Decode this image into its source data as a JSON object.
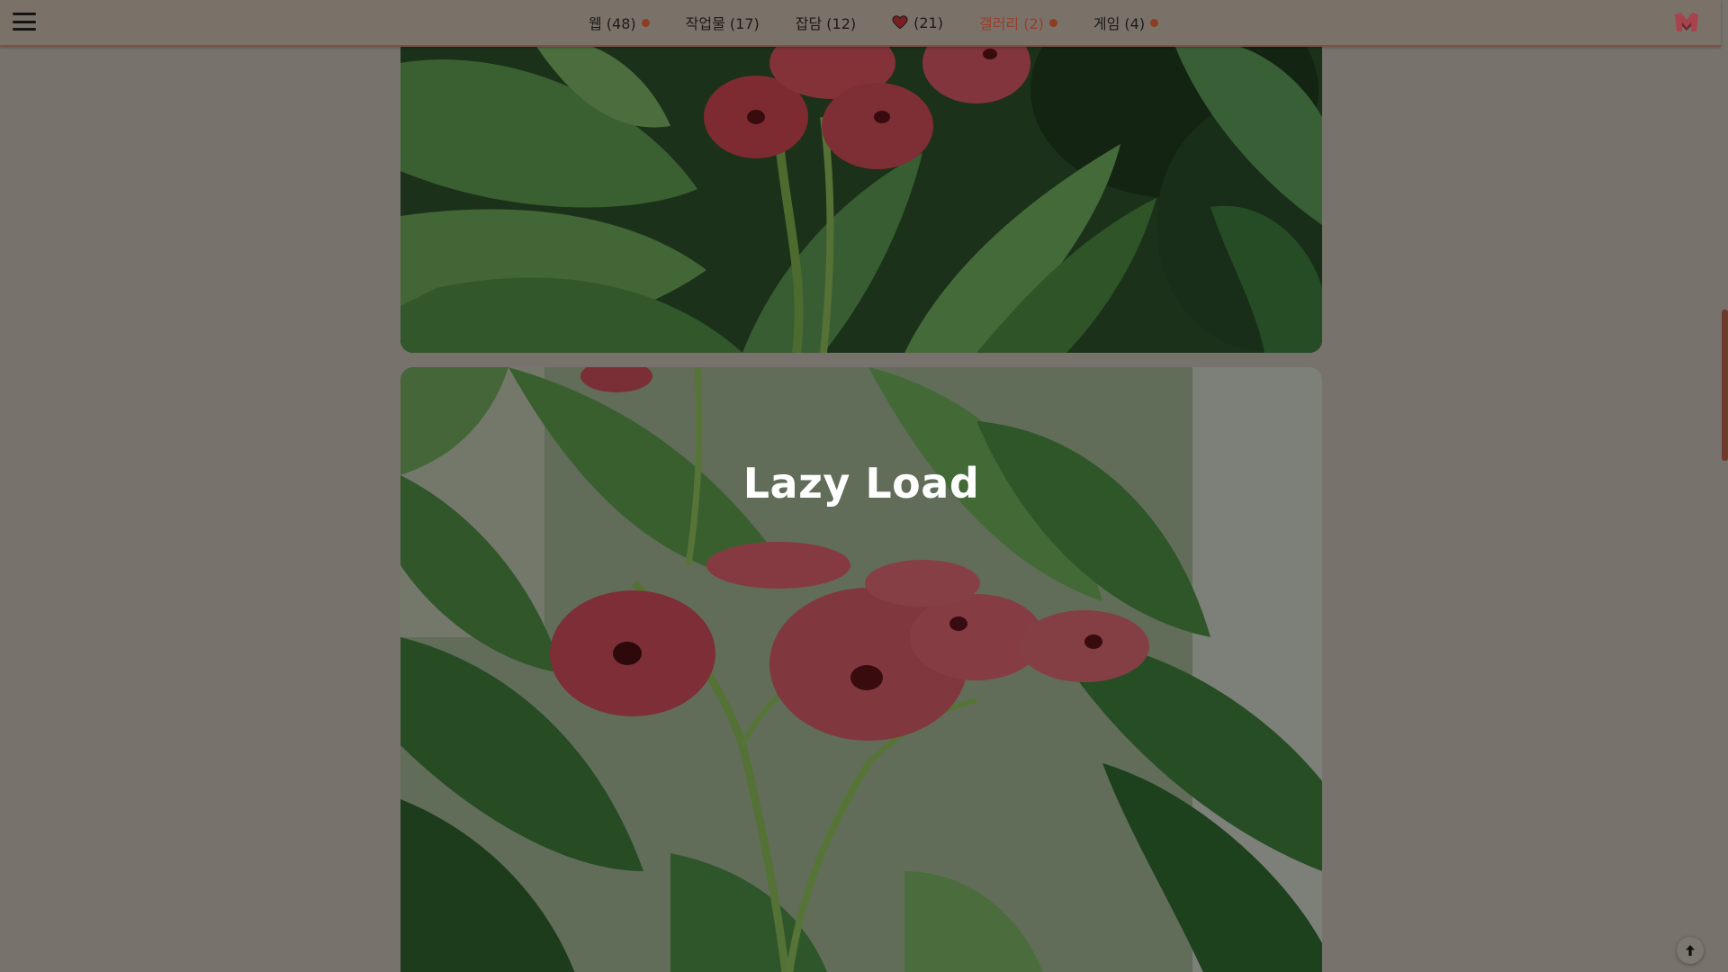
{
  "nav": {
    "items": [
      {
        "label": "웹 (48)",
        "dot": true,
        "active": false
      },
      {
        "label": "작업물 (17)",
        "dot": false,
        "active": false
      },
      {
        "label": "잡담 (12)",
        "dot": false,
        "active": false
      },
      {
        "label": "(21)",
        "dot": false,
        "active": false,
        "icon": "heart-icon"
      },
      {
        "label": "갤러리 (2)",
        "dot": true,
        "active": true
      },
      {
        "label": "게임 (4)",
        "dot": true,
        "active": false
      }
    ]
  },
  "content": {
    "overlay_title": "Lazy Load"
  },
  "icons": {
    "menu": "hamburger-menu-icon",
    "logo": "logo-icon",
    "back_to_top": "arrow-up-icon"
  },
  "colors": {
    "accent": "#9a3c28",
    "dot": "#8e3c22",
    "scrollbar": "#6d3a2b"
  }
}
